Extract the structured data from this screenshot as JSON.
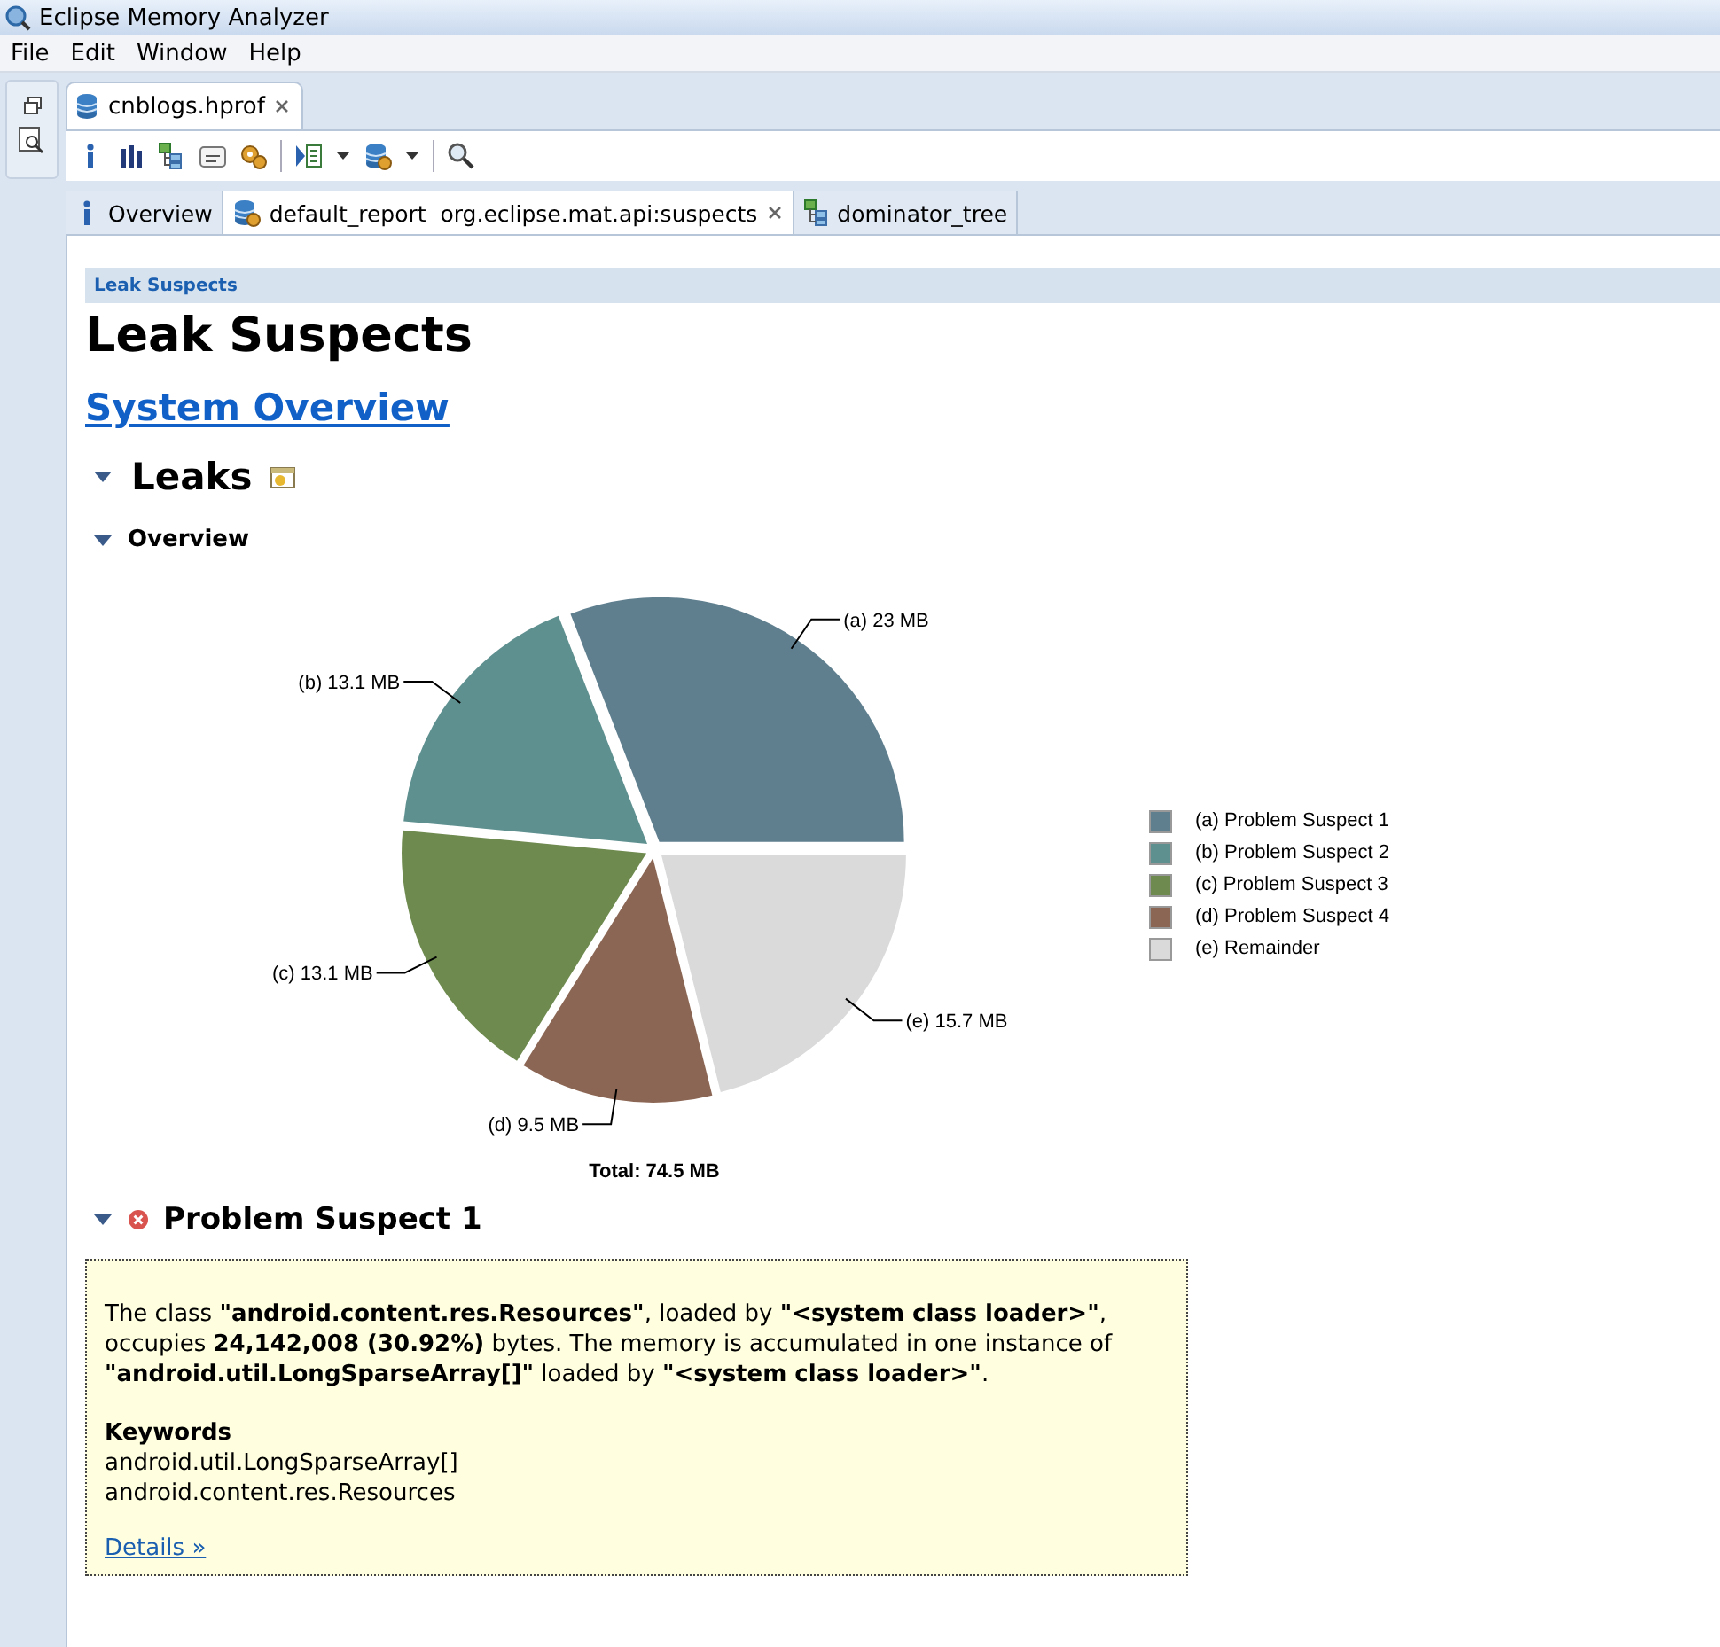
{
  "window": {
    "title": "Eclipse Memory Analyzer"
  },
  "menu": [
    "File",
    "Edit",
    "Window",
    "Help"
  ],
  "editor_tab": {
    "label": "cnblogs.hprof",
    "selected": true
  },
  "report_tabs": [
    {
      "kind": "info",
      "label": "Overview",
      "selected": false
    },
    {
      "kind": "report",
      "label": "default_report  org.eclipse.mat.api:suspects",
      "selected": true
    },
    {
      "kind": "tree",
      "label": "dominator_tree",
      "selected": false
    }
  ],
  "report": {
    "breadcrumb": "Leak Suspects",
    "title": "Leak Suspects",
    "overview_link": "System Overview",
    "leaks": {
      "title": "Leaks",
      "expanded": true,
      "overview": {
        "title": "Overview",
        "expanded": true,
        "chart_data": {
          "type": "pie",
          "title": "Total: 74.5 MB",
          "categories": [
            "(a)  Problem Suspect 1",
            "(b)  Problem Suspect 2",
            "(c)  Problem Suspect 3",
            "(d)  Problem Suspect 4",
            "(e)  Remainder"
          ],
          "values": [
            23,
            13.1,
            13.1,
            9.5,
            15.7
          ],
          "value_labels": [
            "(a)  23 MB",
            "(b)  13.1 MB",
            "(c)  13.1 MB",
            "(d)  9.5 MB",
            "(e)  15.7 MB"
          ],
          "colors": [
            "#5f7f8f",
            "#5f9090",
            "#6e8a4e",
            "#8c6654",
            "#dadada"
          ]
        }
      }
    },
    "suspect": {
      "title": "Problem Suspect 1",
      "expanded": true,
      "description": "The class **\"android.content.res.Resources\"**, loaded by **\"<system class loader>\"**, occupies **24,142,008 (30.92%)** bytes. The memory is accumulated in one instance of **\"android.util.LongSparseArray[]\"** loaded by **\"<system class loader>\"**.",
      "keywords_heading": "Keywords",
      "keywords": [
        "android.util.LongSparseArray[]",
        "android.content.res.Resources"
      ],
      "details_link": "Details »"
    }
  }
}
